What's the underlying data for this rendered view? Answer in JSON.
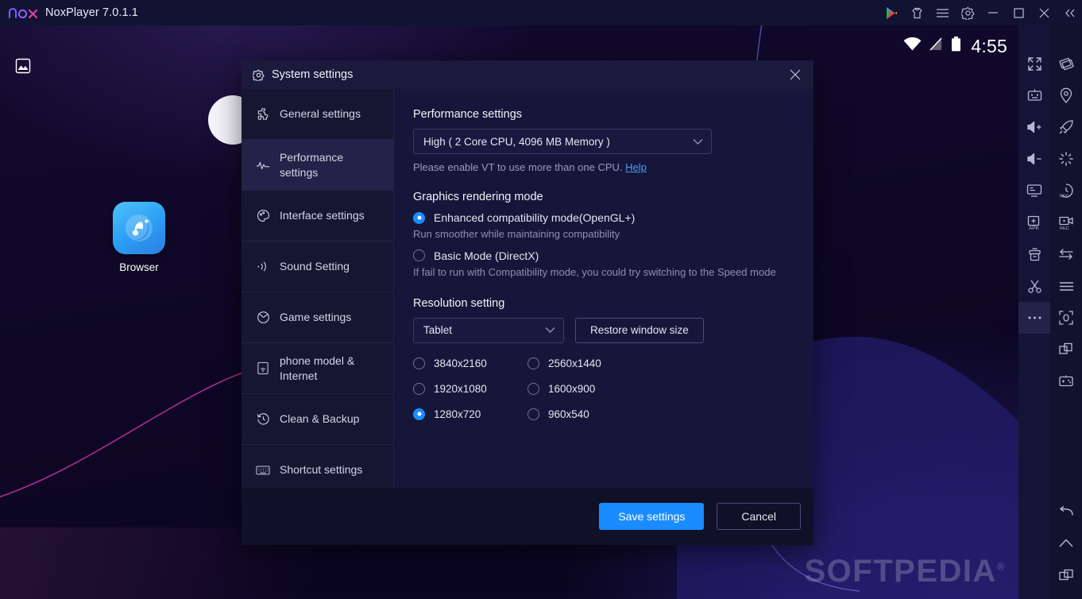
{
  "titlebar": {
    "app_title": "NoxPlayer 7.0.1.1",
    "logo_text": "nox",
    "buttons": [
      {
        "name": "play-store-icon",
        "label": "Google Play"
      },
      {
        "name": "tshirt-icon",
        "label": "Theme"
      },
      {
        "name": "menu-icon",
        "label": "Menu"
      },
      {
        "name": "gear-icon",
        "label": "Settings"
      },
      {
        "name": "minimize-icon",
        "label": "Minimize"
      },
      {
        "name": "maximize-icon",
        "label": "Maximize"
      },
      {
        "name": "close-icon",
        "label": "Close"
      },
      {
        "name": "collapse-icon",
        "label": "Collapse toolbar"
      }
    ]
  },
  "android": {
    "status": {
      "clock": "4:55",
      "wifi": "wifi-icon",
      "signal": "signal-off-icon",
      "battery": "battery-icon"
    },
    "topleft_icon": "image-icon",
    "app_icon": {
      "label": "Browser",
      "icon": "browser-globe-icon"
    },
    "watermark": {
      "text": "SOFTPEDIA",
      "mark": "®"
    }
  },
  "toolbar_inner": [
    {
      "name": "fullscreen-icon",
      "label": "Fullscreen"
    },
    {
      "name": "keyboard-macro-icon",
      "label": "Macro recorder"
    },
    {
      "name": "volume-up-icon",
      "label": "Volume up"
    },
    {
      "name": "volume-down-icon",
      "label": "Volume down"
    },
    {
      "name": "screenshot-icon",
      "label": "Screenshot"
    },
    {
      "name": "install-apk-icon",
      "label": "Install APK"
    },
    {
      "name": "shared-folder-icon",
      "label": "Shared folder"
    },
    {
      "name": "scissors-icon",
      "label": "Cut / crop"
    },
    {
      "name": "more-options-icon",
      "label": "More"
    }
  ],
  "toolbar_outer": [
    {
      "name": "shake-icon",
      "label": "Shake"
    },
    {
      "name": "location-pin-icon",
      "label": "Location"
    },
    {
      "name": "rocket-boost-icon",
      "label": "Speed boost"
    },
    {
      "name": "one-click-icon",
      "label": "One-click operation"
    },
    {
      "name": "screen-record-icon",
      "label": "Screen record"
    },
    {
      "name": "video-record-icon",
      "label": "Video record"
    },
    {
      "name": "sync-operation-icon",
      "label": "Sync operation"
    },
    {
      "name": "menu-list-icon",
      "label": "Menu"
    },
    {
      "name": "scan-qr-icon",
      "label": "Scan QR code"
    },
    {
      "name": "multi-instance-icon",
      "label": "Multi-instance"
    },
    {
      "name": "gamepad-icon",
      "label": "Gamepad / keyboard"
    }
  ],
  "nav_bar": [
    {
      "name": "android-back-icon",
      "label": "Back"
    },
    {
      "name": "android-home-icon",
      "label": "Home"
    },
    {
      "name": "android-recents-icon",
      "label": "Recents"
    }
  ],
  "dialog": {
    "title": "System settings",
    "title_icon": "gear-icon",
    "close_icon": "close-icon",
    "sidebar": [
      {
        "label": "General settings",
        "icon": "puzzle-icon",
        "active": false
      },
      {
        "label": "Performance settings",
        "icon": "pulse-icon",
        "active": true
      },
      {
        "label": "Interface settings",
        "icon": "palette-icon",
        "active": false
      },
      {
        "label": "Sound Setting",
        "icon": "sound-wave-icon",
        "active": false
      },
      {
        "label": "Game settings",
        "icon": "game-pie-icon",
        "active": false
      },
      {
        "label": "phone model & Internet",
        "icon": "phone-wifi-icon",
        "active": false
      },
      {
        "label": "Clean & Backup",
        "icon": "clock-restore-icon",
        "active": false
      },
      {
        "label": "Shortcut settings",
        "icon": "keyboard-icon",
        "active": false
      }
    ],
    "performance": {
      "section_title": "Performance settings",
      "selected": "High ( 2 Core CPU, 4096 MB Memory )",
      "hint_text": "Please enable VT to use more than one CPU.",
      "hint_link": "Help"
    },
    "graphics": {
      "section_title": "Graphics rendering mode",
      "options": [
        {
          "label": "Enhanced compatibility mode(OpenGL+)",
          "checked": true,
          "note": "Run smoother while maintaining compatibility"
        },
        {
          "label": "Basic Mode (DirectX)",
          "checked": false,
          "note": " If fail to run with Compatibility mode, you could try switching to the Speed mode"
        }
      ]
    },
    "resolution": {
      "section_title": "Resolution setting",
      "mode_selected": "Tablet",
      "restore_button": "Restore window size",
      "options": [
        {
          "label": "3840x2160",
          "checked": false
        },
        {
          "label": "2560x1440",
          "checked": false
        },
        {
          "label": "1920x1080",
          "checked": false
        },
        {
          "label": "1600x900",
          "checked": false
        },
        {
          "label": "1280x720",
          "checked": true
        },
        {
          "label": "960x540",
          "checked": false
        }
      ]
    },
    "footer": {
      "save_label": "Save settings",
      "cancel_label": "Cancel"
    }
  },
  "colors": {
    "accent": "#1a8cff",
    "titlebar_bg": "#121233",
    "dialog_bg": "#16163a",
    "link": "#4a9bf0"
  }
}
